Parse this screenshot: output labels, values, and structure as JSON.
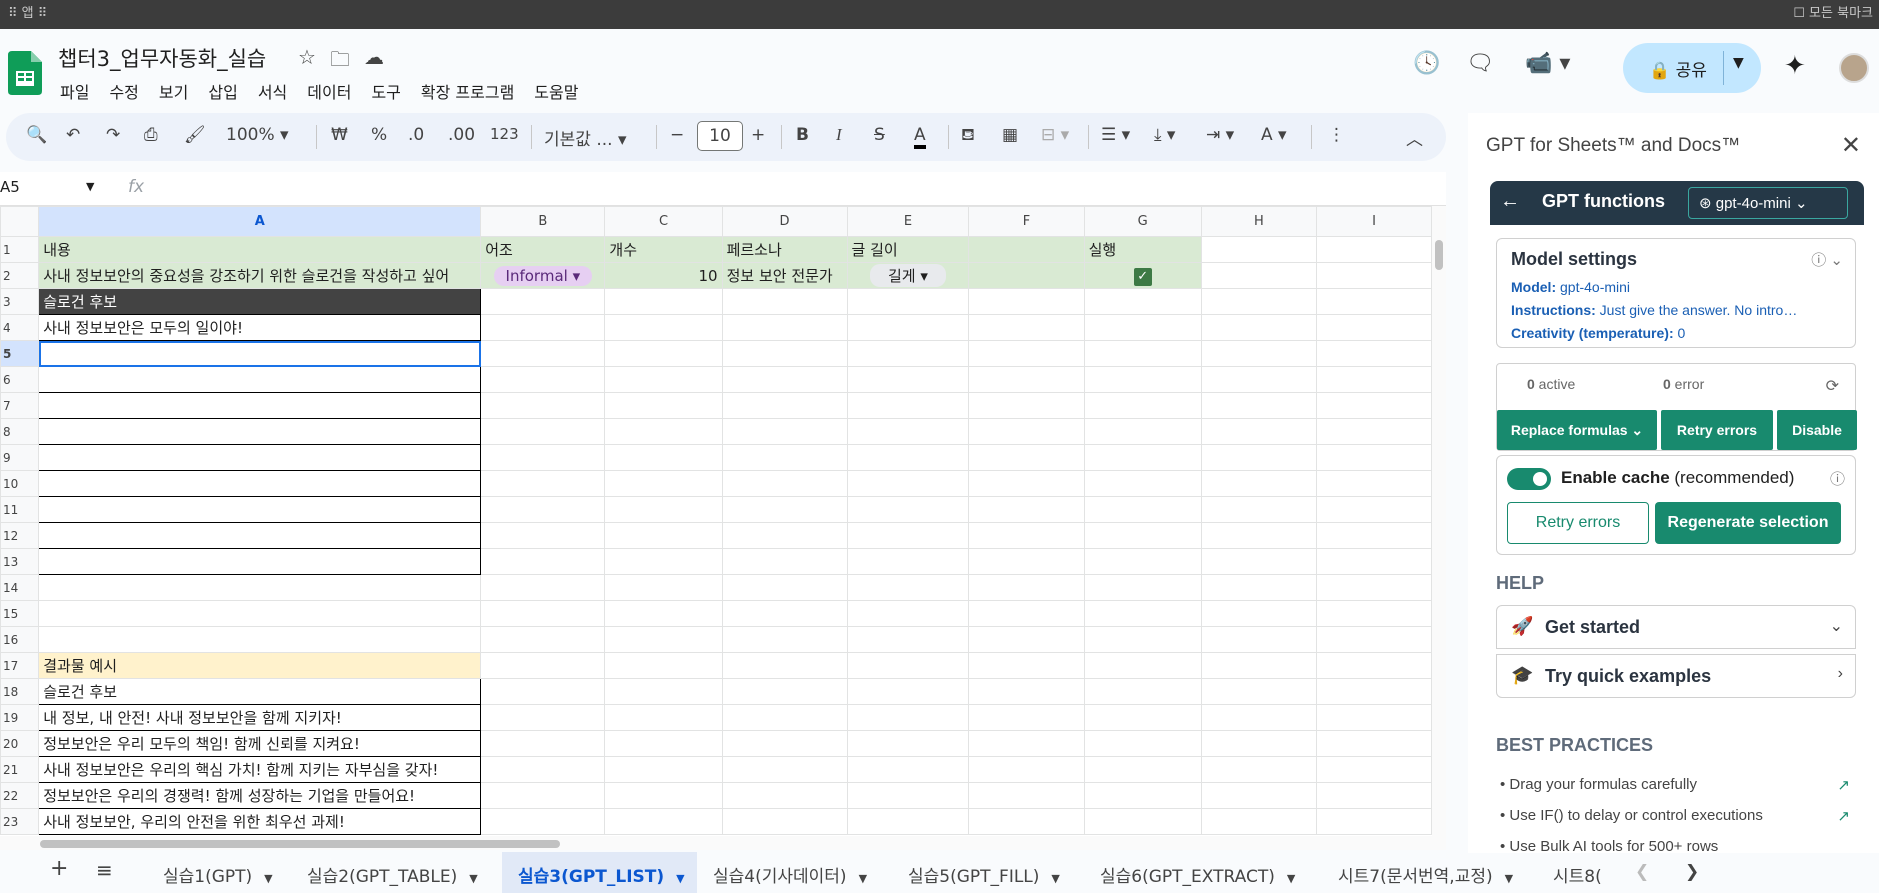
{
  "topstrip": {
    "left": "⠿ 앱  ⠿",
    "right": "☐ 모든 북마크"
  },
  "doc": {
    "title": "챕터3_업무자동화_실습"
  },
  "menu": [
    "파일",
    "수정",
    "보기",
    "삽입",
    "서식",
    "데이터",
    "도구",
    "확장 프로그램",
    "도움말"
  ],
  "share": {
    "label": "공유"
  },
  "toolbar": {
    "zoom": "100%",
    "currency": "₩",
    "percent": "%",
    "dec_dec": ".0",
    "dec_inc": ".00",
    "num_fmt": "123",
    "font": "기본값 ...",
    "font_size": "10"
  },
  "namebox": {
    "value": "A5",
    "fx": "fx"
  },
  "columns": [
    "A",
    "B",
    "C",
    "D",
    "E",
    "F",
    "G",
    "H",
    "I"
  ],
  "rows": {
    "r1": {
      "a": "내용",
      "b": "어조",
      "c": "개수",
      "d": "페르소나",
      "e": "글 길이",
      "g": "실행"
    },
    "r2": {
      "a": "사내 정보보안의 중요성을 강조하기 위한 슬로건을 작성하고 싶어",
      "b": "Informal",
      "c": "10",
      "d": "정보 보안 전문가",
      "e": "길게"
    },
    "r3": {
      "a": "슬로건 후보"
    },
    "r4": {
      "a": "사내 정보보안은 모두의 일이야!"
    },
    "r17": {
      "a": "결과물 예시"
    },
    "r18": {
      "a": "슬로건 후보"
    },
    "r19": {
      "a": "내 정보, 내 안전! 사내 정보보안을 함께 지키자!"
    },
    "r20": {
      "a": "정보보안은 우리 모두의 책임! 함께 신뢰를 지켜요!"
    },
    "r21": {
      "a": "사내 정보보안은 우리의 핵심 가치! 함께 지키는 자부심을 갖자!"
    },
    "r22": {
      "a": "정보보안은 우리의 경쟁력! 함께 성장하는 기업을 만들어요!"
    },
    "r23": {
      "a": "사내 정보보안, 우리의 안전을 위한 최우선 과제!"
    }
  },
  "tabs": [
    "실습1(GPT)",
    "실습2(GPT_TABLE)",
    "실습3(GPT_LIST)",
    "실습4(기사데이터)",
    "실습5(GPT_FILL)",
    "실습6(GPT_EXTRACT)",
    "시트7(문서번역,교정)",
    "시트8(:"
  ],
  "panel": {
    "title": "GPT for Sheets™ and Docs™",
    "functions_label": "GPT functions",
    "model_select": "gpt-4o-mini",
    "model_settings": {
      "heading": "Model settings",
      "model_key": "Model:",
      "model_val": " gpt-4o-mini",
      "instr_key": "Instructions:",
      "instr_val": " Just give the answer. No intro…",
      "creat_key": "Creativity (temperature):",
      "creat_val": " 0"
    },
    "status": {
      "active_count": "0",
      "active_label": " active",
      "error_count": "0",
      "error_label": " error"
    },
    "buttons": {
      "replace": "Replace formulas ⌄",
      "retry": "Retry errors",
      "disable": "Disable"
    },
    "cache": {
      "label": "Enable cache",
      "suffix": " (recommended)",
      "retry": "Retry errors",
      "regen": "Regenerate selection"
    },
    "help": {
      "heading": "HELP",
      "get_started": "Get started",
      "quick": "Try quick examples"
    },
    "best": {
      "heading": "BEST PRACTICES",
      "items": [
        "Drag your formulas carefully",
        "Use IF() to delay or control executions",
        "Use Bulk AI tools for 500+ rows"
      ]
    }
  },
  "colors": {
    "accent": "#188a6e",
    "header_dark": "#253847",
    "share_bg": "#c2e7ff",
    "green_row": "#d9ead3",
    "yellow_row": "#fff2cc"
  }
}
